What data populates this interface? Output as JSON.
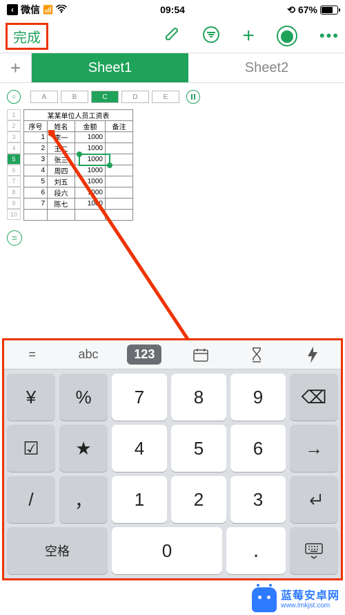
{
  "status": {
    "app_back": "微信",
    "signal": ".ıll",
    "wifi": "✦",
    "time": "09:54",
    "clock_icon": "◉",
    "battery_pct": "67%"
  },
  "toolbar": {
    "done_label": "完成"
  },
  "sheets": {
    "tabs": [
      {
        "label": "Sheet1",
        "active": true
      },
      {
        "label": "Sheet2",
        "active": false
      }
    ]
  },
  "columns": [
    "A",
    "B",
    "C",
    "D",
    "E"
  ],
  "selected_col": "C",
  "selected_row": 5,
  "row_numbers": [
    1,
    2,
    3,
    4,
    5,
    6,
    7,
    8,
    9,
    10
  ],
  "table": {
    "title": "某某单位人员工资表",
    "headers": [
      "序号",
      "姓名",
      "金额",
      "备注"
    ],
    "rows": [
      {
        "no": 1,
        "name": "李一",
        "amount": 1000
      },
      {
        "no": 2,
        "name": "王二",
        "amount": 1000
      },
      {
        "no": 3,
        "name": "张三",
        "amount": 1000
      },
      {
        "no": 4,
        "name": "周四",
        "amount": 1000
      },
      {
        "no": 5,
        "name": "刘五",
        "amount": 1000
      },
      {
        "no": 6,
        "name": "段六",
        "amount": 1000
      },
      {
        "no": 7,
        "name": "陈七",
        "amount": 1000
      }
    ]
  },
  "keyboard": {
    "toolbar": {
      "eq": "=",
      "abc": "abc",
      "num": "123"
    },
    "left_col": [
      "¥",
      "%",
      "☑",
      "★",
      "/",
      "，"
    ],
    "num_grid": [
      [
        "7",
        "8",
        "9"
      ],
      [
        "4",
        "5",
        "6"
      ],
      [
        "1",
        "2",
        "3"
      ]
    ],
    "zero": "0",
    "dot": ".",
    "space": "空格",
    "right_col": {
      "backspace": "⌫",
      "arrow": "→",
      "enter": "↵"
    }
  },
  "watermark": {
    "title": "蓝莓安卓网",
    "url": "www.lmkjst.com"
  }
}
